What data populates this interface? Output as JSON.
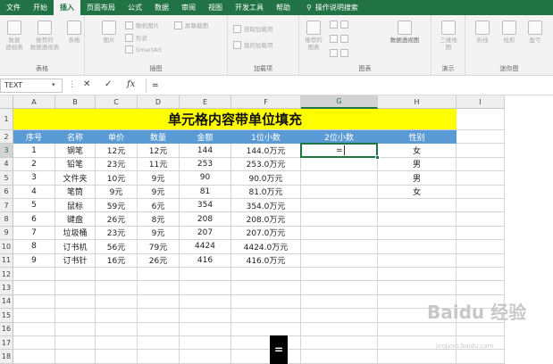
{
  "tabs": [
    {
      "label": "文件",
      "active": false
    },
    {
      "label": "开始",
      "active": false
    },
    {
      "label": "插入",
      "active": true
    },
    {
      "label": "页面布局",
      "active": false
    },
    {
      "label": "公式",
      "active": false
    },
    {
      "label": "数据",
      "active": false
    },
    {
      "label": "审阅",
      "active": false
    },
    {
      "label": "视图",
      "active": false
    },
    {
      "label": "开发工具",
      "active": false
    },
    {
      "label": "帮助",
      "active": false
    }
  ],
  "tell_me": {
    "icon": "lightbulb-icon",
    "label": "操作说明搜索"
  },
  "ribbon": {
    "groups": [
      {
        "label": "表格"
      },
      {
        "label": "插图"
      },
      {
        "label": "加载项"
      },
      {
        "label": "图表"
      },
      {
        "label": "演示"
      },
      {
        "label": "迷你图"
      }
    ],
    "buttons": {
      "pivot": "数据\n透视表",
      "recommended_pivot": "推荐的\n数据透视表",
      "table": "表格",
      "pictures": "图片",
      "online_pictures": "联机图片",
      "shapes": "形状",
      "smartart": "SmartArt",
      "screenshot": "屏幕截图",
      "get_addins": "获取加载项",
      "my_addins": "我的加载项",
      "recommended_charts": "推荐的\n图表",
      "pivot_chart": "数据透视图",
      "map_3d": "三维地\n图",
      "sparkline_line": "折线",
      "sparkline_column": "柱形",
      "sparkline_winloss": "盈亏"
    }
  },
  "formula_bar": {
    "name_box": "TEXT",
    "cancel_icon": "close-icon",
    "enter_icon": "check-icon",
    "fx_label": "fx",
    "formula": "="
  },
  "columns": [
    "A",
    "B",
    "C",
    "D",
    "E",
    "F",
    "G",
    "H",
    "I"
  ],
  "rows": [
    "1",
    "2",
    "3",
    "4",
    "5",
    "6",
    "7",
    "8",
    "9",
    "10",
    "11",
    "12",
    "13",
    "14",
    "15",
    "16",
    "17",
    "18"
  ],
  "sheet": {
    "title": "单元格内容带单位填充",
    "headers": [
      "序号",
      "名称",
      "单价",
      "数量",
      "金额",
      "1位小数",
      "2位小数",
      "性别"
    ],
    "data": [
      [
        "1",
        "钢笔",
        "12元",
        "12元",
        "144",
        "144.0万元",
        "",
        "女"
      ],
      [
        "2",
        "铅笔",
        "23元",
        "11元",
        "253",
        "253.0万元",
        "",
        "男"
      ],
      [
        "3",
        "文件夹",
        "10元",
        "9元",
        "90",
        "90.0万元",
        "",
        "男"
      ],
      [
        "4",
        "笔筒",
        "9元",
        "9元",
        "81",
        "81.0万元",
        "",
        "女"
      ],
      [
        "5",
        "鼠标",
        "59元",
        "6元",
        "354",
        "354.0万元",
        "",
        ""
      ],
      [
        "6",
        "键盘",
        "26元",
        "8元",
        "208",
        "208.0万元",
        "",
        ""
      ],
      [
        "7",
        "垃圾桶",
        "23元",
        "9元",
        "207",
        "207.0万元",
        "",
        ""
      ],
      [
        "8",
        "订书机",
        "56元",
        "79元",
        "4424",
        "4424.0万元",
        "",
        ""
      ],
      [
        "9",
        "订书针",
        "16元",
        "26元",
        "416",
        "416.0万元",
        "",
        ""
      ]
    ],
    "active_cell_value": "=",
    "selected_column": "G",
    "selected_row": "3"
  },
  "watermark": {
    "main": "Baidu 经验",
    "sub": "jingyan.baidu.com"
  },
  "overlay_key": "="
}
